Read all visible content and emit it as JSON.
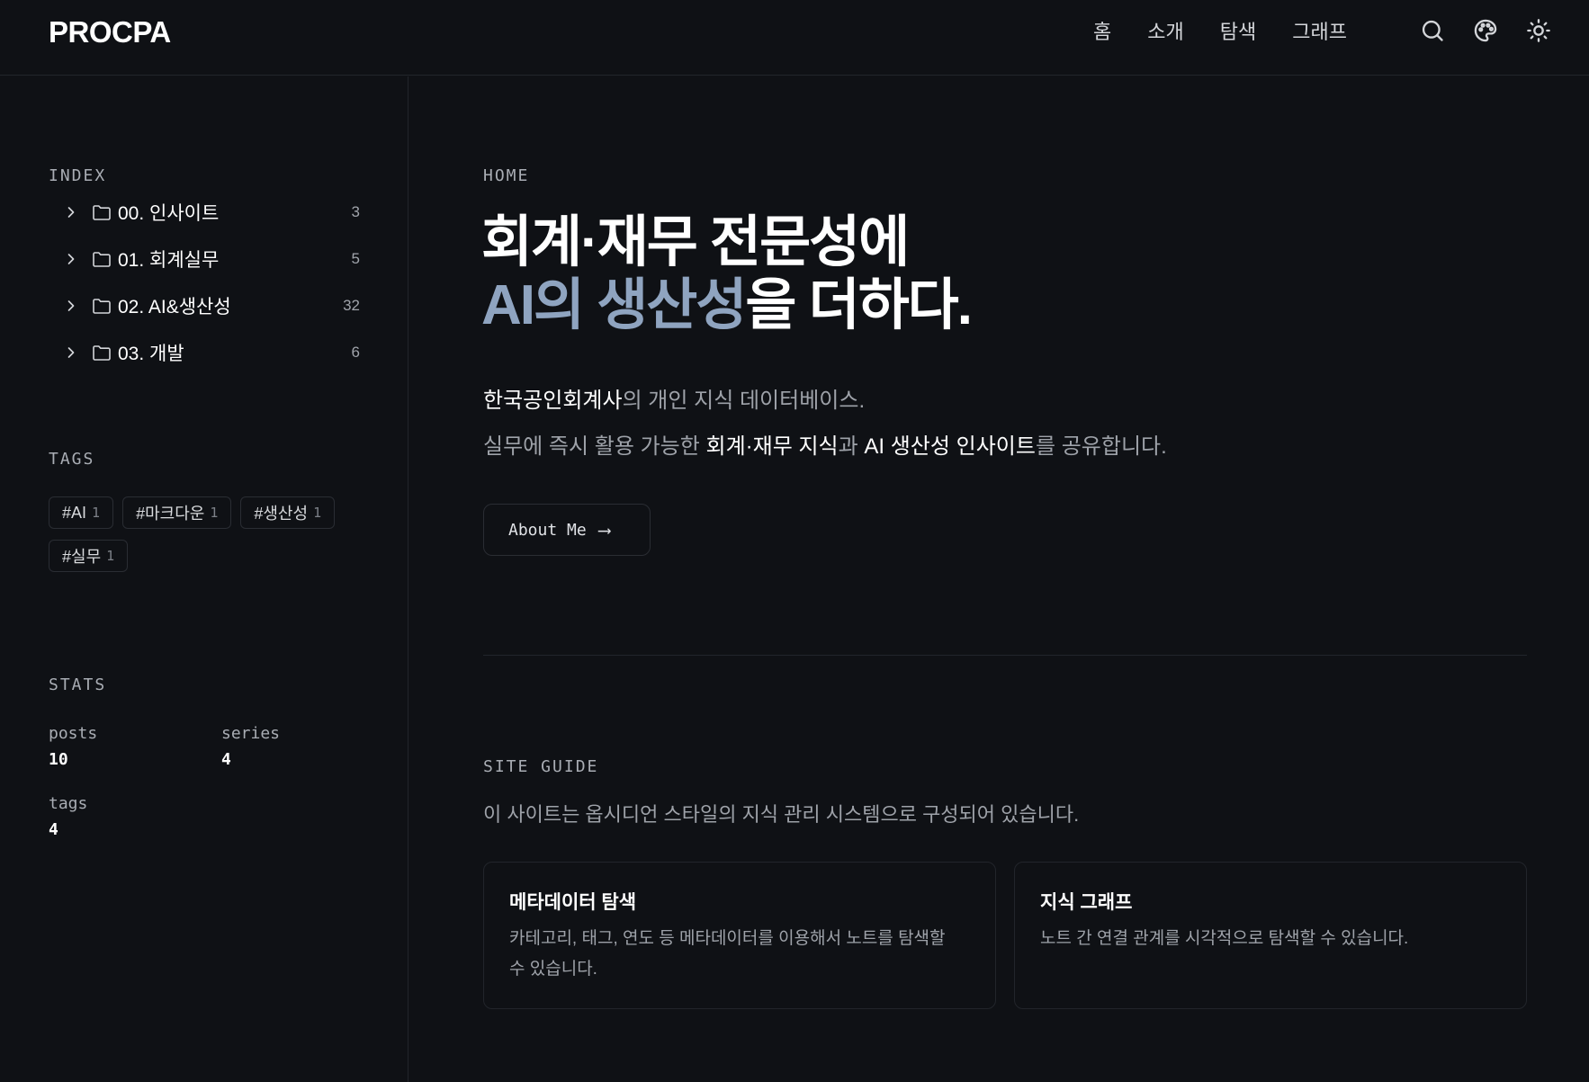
{
  "header": {
    "logo": "PROCPA",
    "nav": [
      "홈",
      "소개",
      "탐색",
      "그래프"
    ],
    "icons": [
      "search-icon",
      "palette-icon",
      "theme-toggle-icon"
    ]
  },
  "sidebar": {
    "index_label": "INDEX",
    "index": [
      {
        "name": "00. 인사이트",
        "count": "3"
      },
      {
        "name": "01. 회계실무",
        "count": "5"
      },
      {
        "name": "02. AI&생산성",
        "count": "32"
      },
      {
        "name": "03. 개발",
        "count": "6"
      }
    ],
    "tags_label": "TAGS",
    "tags": [
      {
        "name": "#AI",
        "count": "1"
      },
      {
        "name": "#마크다운",
        "count": "1"
      },
      {
        "name": "#생산성",
        "count": "1"
      },
      {
        "name": "#실무",
        "count": "1"
      }
    ],
    "stats_label": "STATS",
    "stats": {
      "posts": {
        "label": "posts",
        "value": "10"
      },
      "series": {
        "label": "series",
        "value": "4"
      },
      "tags": {
        "label": "tags",
        "value": "4"
      }
    }
  },
  "main": {
    "breadcrumb": "HOME",
    "hero_line1": "회계·재무 전문성에",
    "hero_accent": "AI의 생산성",
    "hero_tail": "을 더하다.",
    "lead1_strong": "한국공인회계사",
    "lead1_rest": "의 개인 지식 데이터베이스.",
    "lead2_a": "실무에 즉시 활용 가능한 ",
    "lead2_b": "회계·재무 지식",
    "lead2_c": "과 ",
    "lead2_d": "AI 생산성 인사이트",
    "lead2_e": "를 공유합니다.",
    "about_button": "About Me",
    "about_arrow": "⟶",
    "guide_label": "SITE GUIDE",
    "guide_desc": "이 사이트는 옵시디언 스타일의 지식 관리 시스템으로 구성되어 있습니다.",
    "cards": [
      {
        "title": "메타데이터 탐색",
        "desc": "카테고리, 태그, 연도 등 메타데이터를 이용해서 노트를 탐색할 수 있습니다."
      },
      {
        "title": "지식 그래프",
        "desc": "노트 간 연결 관계를 시각적으로 탐색할 수 있습니다."
      }
    ]
  },
  "colors": {
    "background": "#0f1115",
    "accent": "#8fa4c0",
    "border": "#22252b"
  }
}
